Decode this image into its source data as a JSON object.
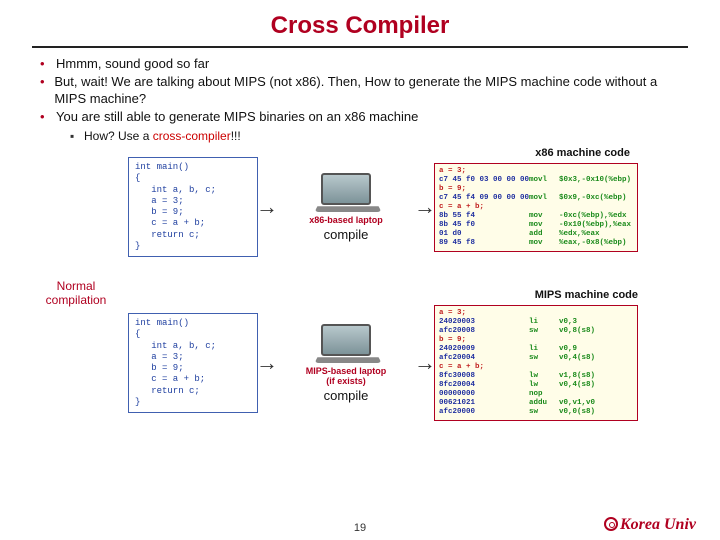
{
  "title": "Cross Compiler",
  "bullets": [
    "Hmmm, sound good so far",
    "But, wait! We are talking about MIPS (not x86). Then, How to generate the MIPS machine code without a MIPS machine?",
    "You are still able to generate MIPS binaries on an x86 machine"
  ],
  "sub_prefix": "How? Use a ",
  "sub_red": "cross-compiler",
  "sub_suffix": "!!!",
  "labels": {
    "x86mc": "x86 machine code",
    "mipsmc": "MIPS machine code",
    "normal1": "Normal",
    "normal2": "compilation",
    "x86laptop": "x86-based laptop",
    "mipslaptop": "MIPS-based laptop",
    "ifexists": "(if exists)",
    "compile": "compile"
  },
  "source_code": "int main()\n{\n   int a, b, c;\n   a = 3;\n   b = 9;\n   c = a + b;\n   return c;\n}",
  "x86_rows": [
    {
      "c": "a = 3;",
      "h": "",
      "a1": "",
      "a2": ""
    },
    {
      "c": "",
      "h": "c7 45 f0 03 00 00 00",
      "a1": "movl",
      "a2": "$0x3,-0x10(%ebp)"
    },
    {
      "c": "b = 9;",
      "h": "",
      "a1": "",
      "a2": ""
    },
    {
      "c": "",
      "h": "c7 45 f4 09 00 00 00",
      "a1": "movl",
      "a2": "$0x9,-0xc(%ebp)"
    },
    {
      "c": "c = a + b;",
      "h": "",
      "a1": "",
      "a2": ""
    },
    {
      "c": "",
      "h": "8b 55 f4",
      "a1": "mov",
      "a2": "-0xc(%ebp),%edx"
    },
    {
      "c": "",
      "h": "8b 45 f0",
      "a1": "mov",
      "a2": "-0x10(%ebp),%eax"
    },
    {
      "c": "",
      "h": "01 d0",
      "a1": "add",
      "a2": "%edx,%eax"
    },
    {
      "c": "",
      "h": "89 45 f8",
      "a1": "mov",
      "a2": "%eax,-0x8(%ebp)"
    }
  ],
  "mips_rows": [
    {
      "c": "a = 3;",
      "h": "",
      "a1": "",
      "a2": ""
    },
    {
      "c": "",
      "h": "24020003",
      "a1": "li",
      "a2": "v0,3"
    },
    {
      "c": "",
      "h": "afc20008",
      "a1": "sw",
      "a2": "v0,8(s8)"
    },
    {
      "c": "b = 9;",
      "h": "",
      "a1": "",
      "a2": ""
    },
    {
      "c": "",
      "h": "24020009",
      "a1": "li",
      "a2": "v0,9"
    },
    {
      "c": "",
      "h": "afc20004",
      "a1": "sw",
      "a2": "v0,4(s8)"
    },
    {
      "c": "c = a + b;",
      "h": "",
      "a1": "",
      "a2": ""
    },
    {
      "c": "",
      "h": "8fc30008",
      "a1": "lw",
      "a2": "v1,8(s8)"
    },
    {
      "c": "",
      "h": "8fc20004",
      "a1": "lw",
      "a2": "v0,4(s8)"
    },
    {
      "c": "",
      "h": "00000000",
      "a1": "nop",
      "a2": ""
    },
    {
      "c": "",
      "h": "00621021",
      "a1": "addu",
      "a2": "v0,v1,v0"
    },
    {
      "c": "",
      "h": "afc20000",
      "a1": "sw",
      "a2": "v0,0(s8)"
    }
  ],
  "page": "19",
  "univ": "Korea Univ"
}
